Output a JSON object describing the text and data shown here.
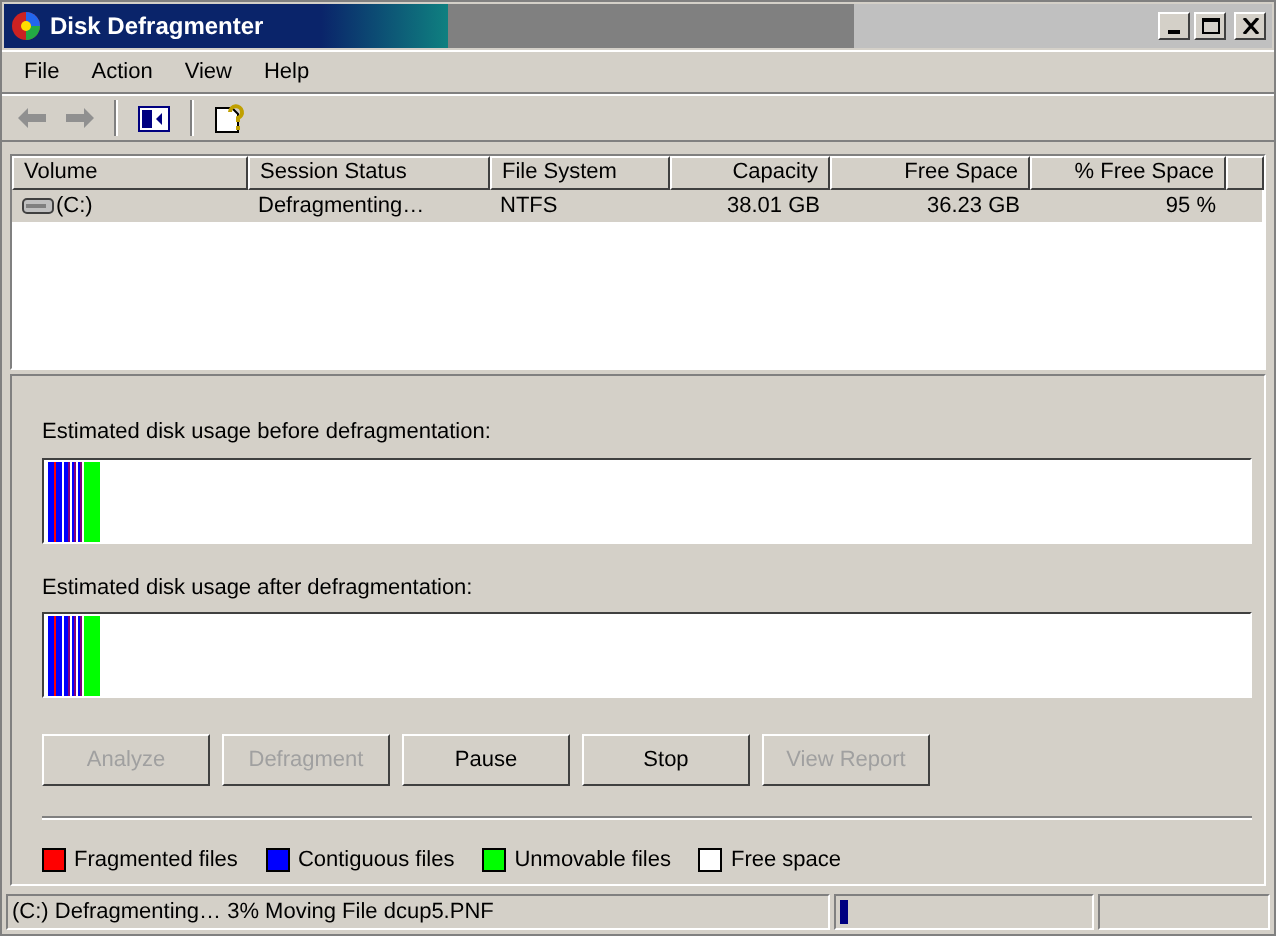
{
  "window": {
    "title": "Disk Defragmenter"
  },
  "menu": [
    "File",
    "Action",
    "View",
    "Help"
  ],
  "table": {
    "columns": [
      {
        "label": "Volume"
      },
      {
        "label": "Session Status"
      },
      {
        "label": "File System"
      },
      {
        "label": "Capacity"
      },
      {
        "label": "Free Space"
      },
      {
        "label": "% Free Space"
      }
    ],
    "rows": [
      {
        "selected": true,
        "cells": [
          "(C:)",
          "Defragmenting…",
          "NTFS",
          "38.01 GB",
          "36.23 GB",
          "95 %"
        ]
      }
    ]
  },
  "maps": [
    {
      "label": "Estimated disk usage before defragmentation:"
    },
    {
      "label": "Estimated disk usage after defragmentation:"
    }
  ],
  "buttons": [
    {
      "label": "Analyze",
      "disabled": true
    },
    {
      "label": "Defragment",
      "disabled": true
    },
    {
      "label": "Pause",
      "disabled": false
    },
    {
      "label": "Stop",
      "disabled": false
    },
    {
      "label": "View Report",
      "disabled": true
    }
  ],
  "legend": [
    {
      "label": "Fragmented files",
      "color": "#ff0000"
    },
    {
      "label": "Contiguous files",
      "color": "#0000ff"
    },
    {
      "label": "Unmovable files",
      "color": "#00ff00"
    },
    {
      "label": "Free space",
      "color": "#ffffff"
    }
  ],
  "status_bar": {
    "text": "(C:) Defragmenting… 3%  Moving File dcup5.PNF",
    "progress": {
      "level": 0.03
    }
  }
}
